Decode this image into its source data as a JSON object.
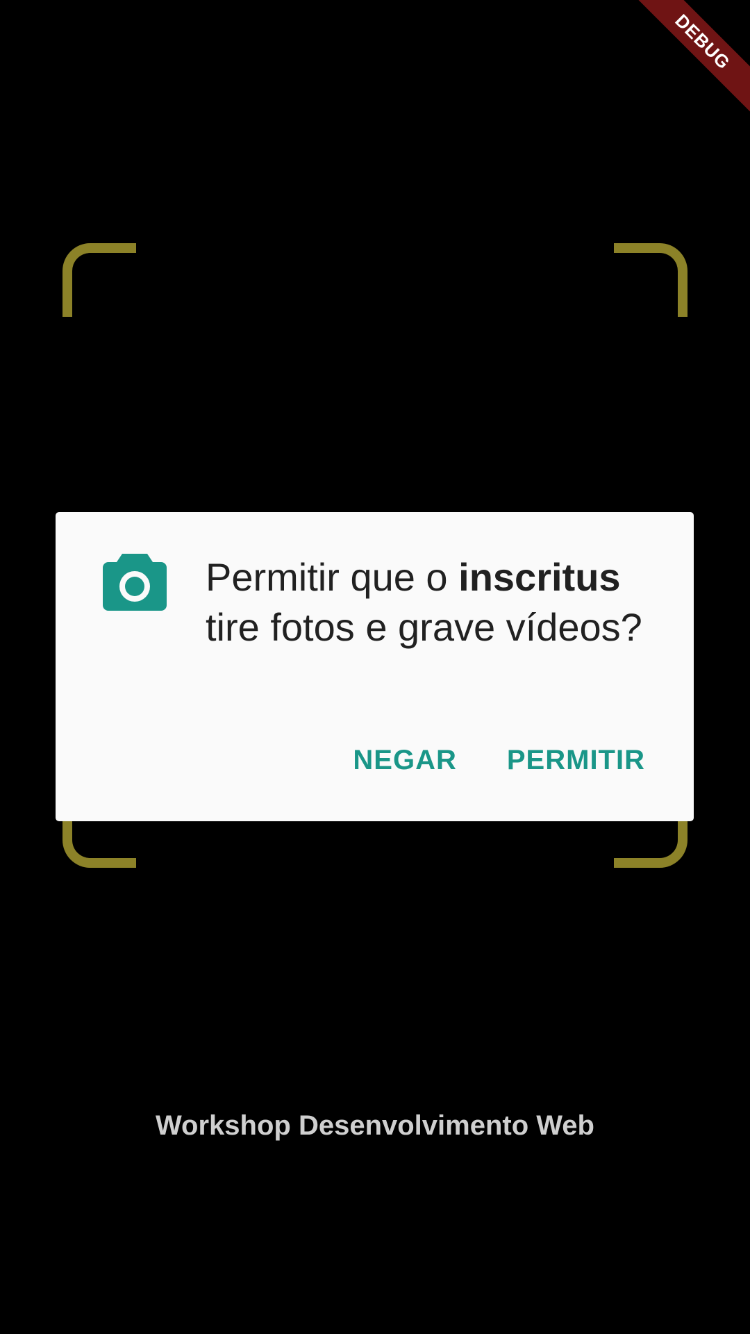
{
  "debug_banner": {
    "label": "DEBUG"
  },
  "permission_dialog": {
    "message_prefix": "Permitir que o ",
    "app_name": "inscritus",
    "message_suffix": " tire fotos e grave vídeos?",
    "deny_label": "NEGAR",
    "allow_label": "PERMITIR",
    "icon": "camera-icon",
    "accent_color": "#1a9688"
  },
  "scanner_frame": {
    "color": "#8c8228"
  },
  "footer": {
    "text": "Workshop Desenvolvimento Web"
  }
}
